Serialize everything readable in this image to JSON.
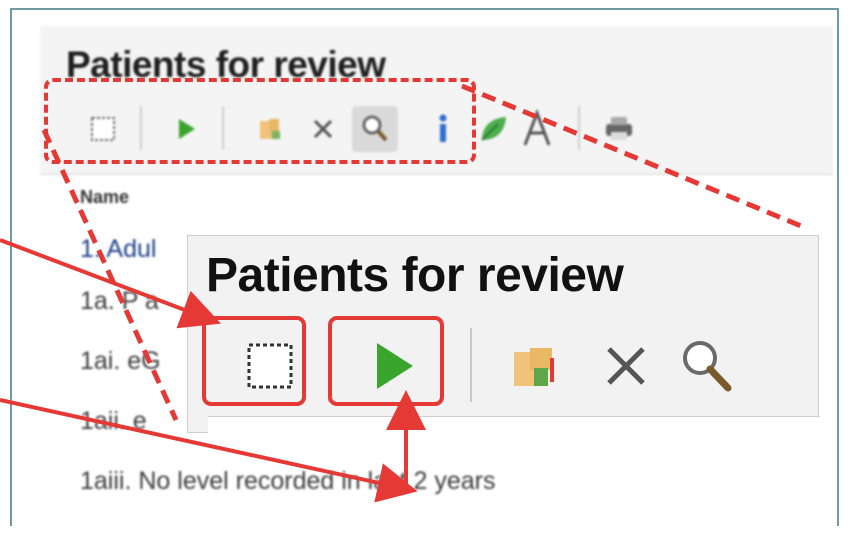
{
  "background_panel": {
    "title": "Patients for review",
    "list_header": "Name",
    "rows": [
      "1. Adul",
      "1a. P a",
      "1ai. eG",
      "1aii. e",
      "1aiii. No level recorded in last 2 years"
    ],
    "toolbar_icons": [
      "select-all-icon",
      "run-icon",
      "export-icon",
      "delete-icon",
      "search-icon",
      "info-icon",
      "leaf-icon",
      "font-icon",
      "print-icon"
    ]
  },
  "inset": {
    "title": "Patients for review",
    "toolbar_icons": [
      "select-all-icon",
      "run-icon",
      "export-icon",
      "delete-icon",
      "search-icon"
    ]
  },
  "colors": {
    "highlight": "#e53935",
    "frame": "#6f9aa0",
    "run_green": "#3aa52d"
  }
}
